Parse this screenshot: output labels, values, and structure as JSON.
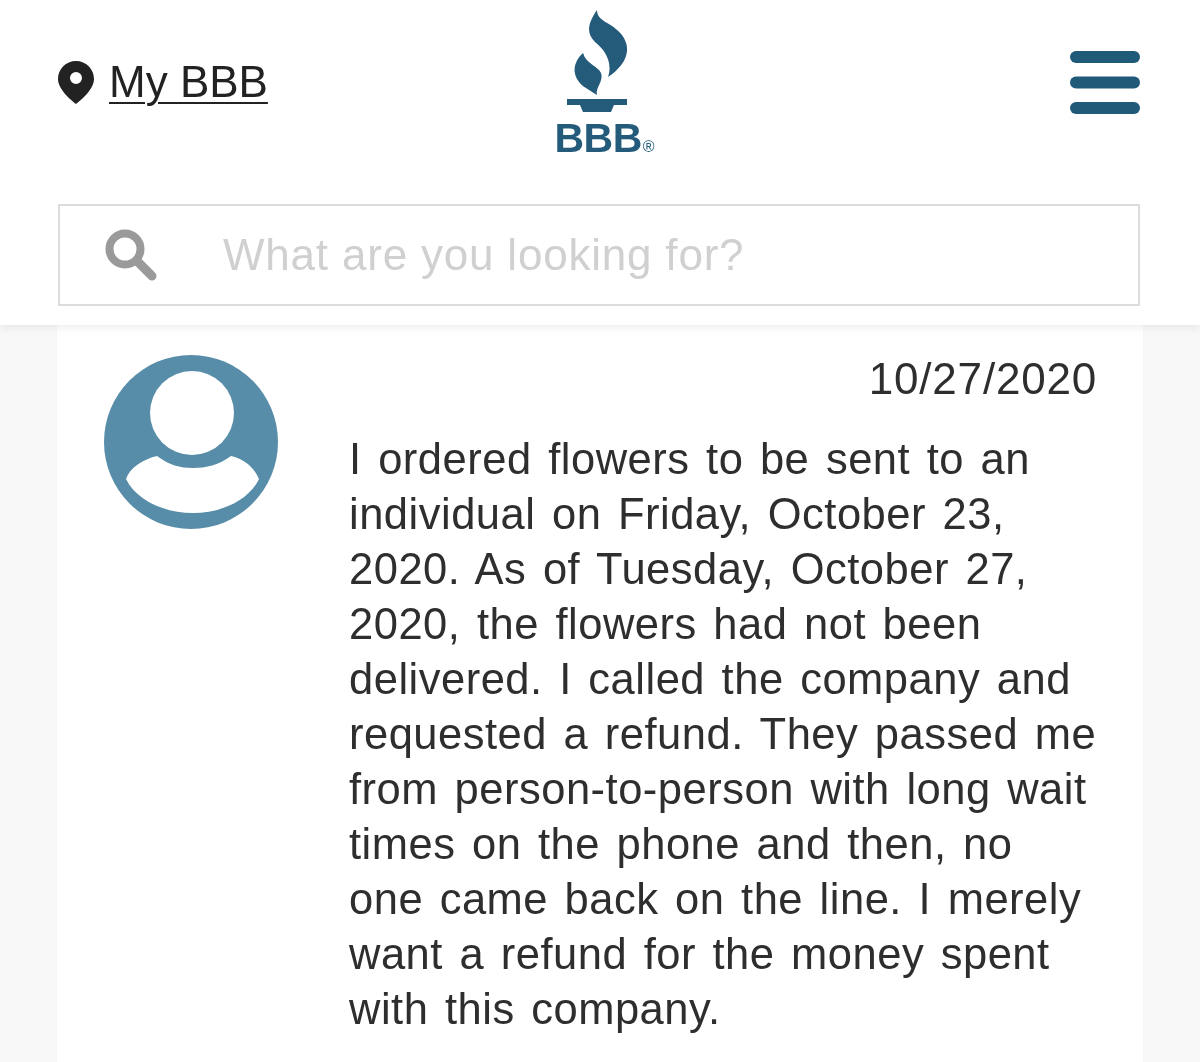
{
  "header": {
    "location_link": {
      "label": "My BBB"
    },
    "logo": {
      "wordmark": "BBB",
      "registered_mark": "®"
    }
  },
  "search": {
    "placeholder": "What are you looking for?"
  },
  "review": {
    "date": "10/27/2020",
    "text": "I ordered flowers to be sent to an individual on Friday, October 23, 2020. As of Tuesday, October 27, 2020, the flowers had not been delivered. I called the company and requested a refund. They passed me from person-to-person with long wait times on the phone and then, no one came back on the line. I merely want a refund for the money spent with this company."
  }
}
